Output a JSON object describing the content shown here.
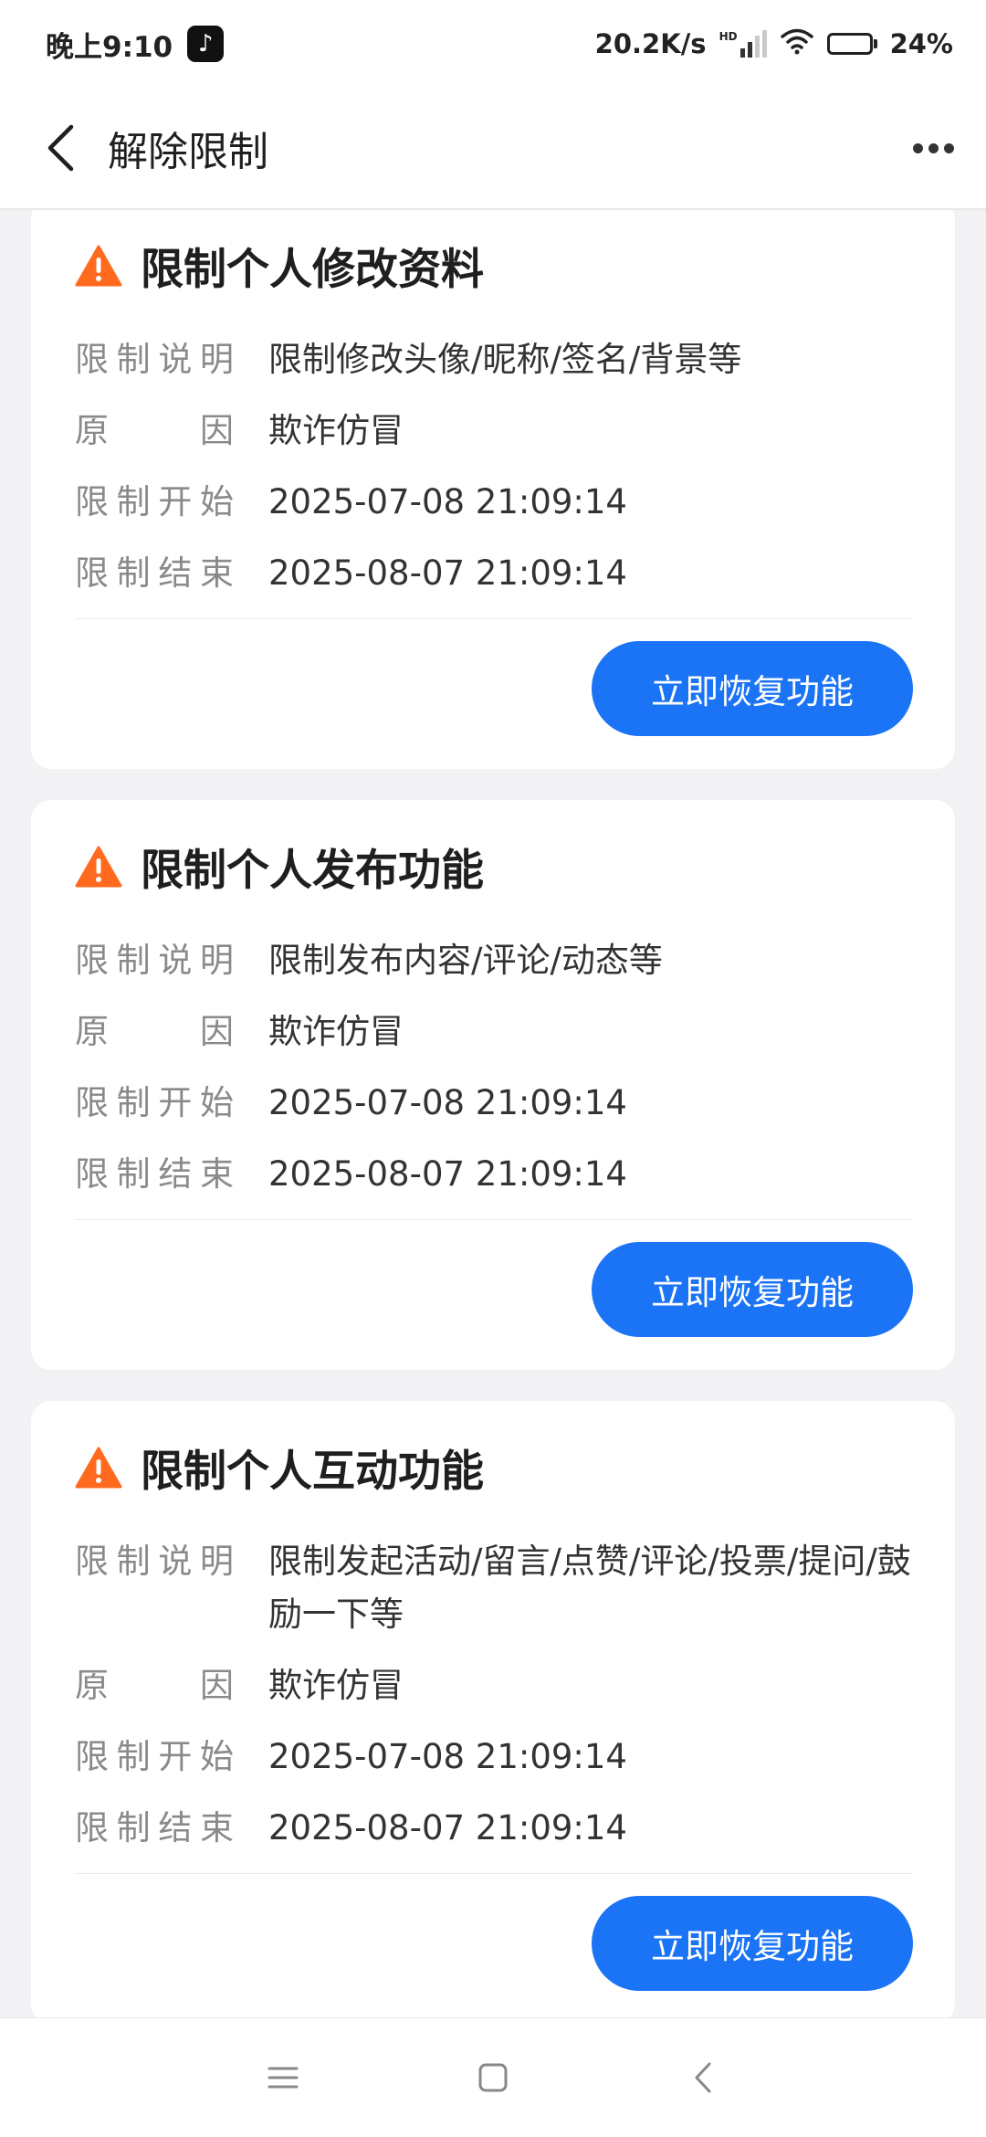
{
  "status_bar": {
    "time": "晚上9:10",
    "app_icon_glyph": "♪",
    "net_speed": "20.2K/s",
    "signal_badge": "HD",
    "battery_percent": "24%",
    "battery_level": 0.24
  },
  "header": {
    "title": "解除限制",
    "back_icon": "chevron-left-icon",
    "more_icon": "more-dots-icon"
  },
  "labels": {
    "desc": [
      "限",
      "制",
      "说",
      "明"
    ],
    "reason": [
      "原",
      "因"
    ],
    "start": [
      "限",
      "制",
      "开",
      "始"
    ],
    "end": [
      "限",
      "制",
      "结",
      "束"
    ]
  },
  "cards": [
    {
      "title": "限制个人修改资料",
      "desc": "限制修改头像/昵称/签名/背景等",
      "reason": "欺诈仿冒",
      "start": "2025-07-08 21:09:14",
      "end": "2025-08-07 21:09:14",
      "button": "立即恢复功能"
    },
    {
      "title": "限制个人发布功能",
      "desc": "限制发布内容/评论/动态等",
      "reason": "欺诈仿冒",
      "start": "2025-07-08 21:09:14",
      "end": "2025-08-07 21:09:14",
      "button": "立即恢复功能"
    },
    {
      "title": "限制个人互动功能",
      "desc": "限制发起活动/留言/点赞/评论/投票/提问/鼓励一下等",
      "reason": "欺诈仿冒",
      "start": "2025-07-08 21:09:14",
      "end": "2025-08-07 21:09:14",
      "button": "立即恢复功能"
    }
  ],
  "colors": {
    "accent": "#1b74f5",
    "warning": "#ff6a1f",
    "background": "#f2f2f4"
  },
  "nav": {
    "menu_icon": "menu-icon",
    "home_icon": "home-square-icon",
    "back_icon": "back-triangle-icon"
  }
}
